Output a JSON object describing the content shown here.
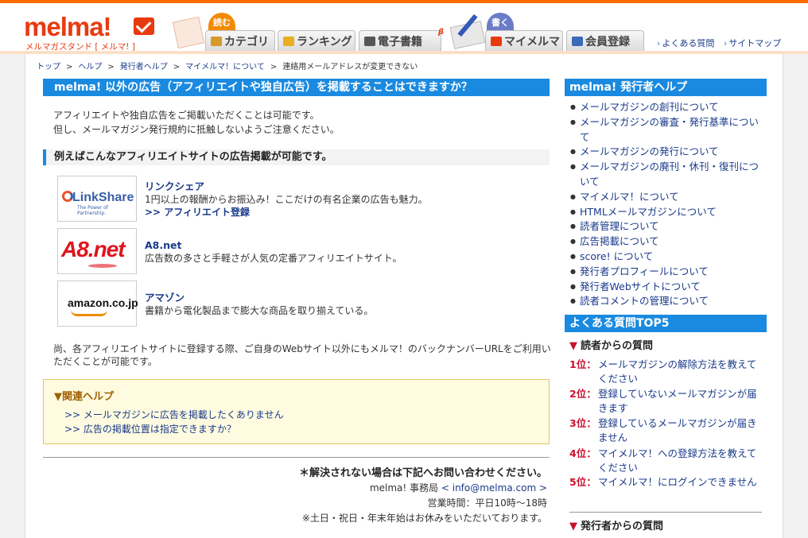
{
  "brand": {
    "name": "melma!",
    "tagline": "メルマガスタンド [ メルマ! ]"
  },
  "modes": {
    "read": "読む",
    "write": "書く"
  },
  "nav": {
    "tabs": [
      {
        "label": "カテゴリ"
      },
      {
        "label": "ランキング"
      },
      {
        "label": "電子書籍",
        "badge": "β"
      },
      {
        "label": "マイメルマ"
      },
      {
        "label": "会員登録"
      }
    ]
  },
  "toplinks": [
    "よくある質問",
    "サイトマップ"
  ],
  "breadcrumb": [
    "トップ",
    "ヘルプ",
    "発行者ヘルプ",
    "マイメルマ！について",
    "連絡用メールアドレスが変更できない"
  ],
  "breadcrumb_sep": ">",
  "main": {
    "title": "melma! 以外の広告（アフィリエイトや独自広告）を掲載することはできますか？",
    "intro": [
      "アフィリエイトや独自広告をご掲載いただくことは可能です。",
      "但し、メールマガジン発行規約に抵触しないようご注意ください。"
    ],
    "subhead": "例えばこんなアフィリエイトサイトの広告掲載が可能です。",
    "affiliates": [
      {
        "logo": "LinkShare",
        "logo_tag": "The Power of Partnership.",
        "name": "リンクシェア",
        "desc": "1円以上の報酬からお振込み！ここだけの有名企業の広告も魅力。",
        "register": ">> アフィリエイト登録"
      },
      {
        "logo": "A8.net",
        "name": "A8.net",
        "desc": "広告数の多さと手軽さが人気の定番アフィリエイトサイト。"
      },
      {
        "logo": "amazon.co.jp",
        "name": "アマゾン",
        "desc": "書籍から電化製品まで膨大な商品を取り揃えている。"
      }
    ],
    "note": "尚、各アフィリエイトサイトに登録する際、ご自身のWebサイト以外にもメルマ！のバックナンバーURLをご利用いただくことが可能です。",
    "related": {
      "title": "▼関連ヘルプ",
      "items": [
        ">> メールマガジンに広告を掲載したくありません",
        ">> 広告の掲載位置は指定できますか？"
      ]
    },
    "contact": {
      "head": "＊解決されない場合は下記へお問い合わせください。",
      "office_prefix": "melma! 事務局",
      "email": "< info@melma.com >",
      "hours": "営業時間：平日10時〜18時",
      "holiday": "※土日・祝日・年末年始はお休みをいただいております。"
    }
  },
  "sidebar": {
    "help_title": "melma! 発行者ヘルプ",
    "help_items": [
      "メールマガジンの創刊について",
      "メールマガジンの審査・発行基準について",
      "メールマガジンの発行について",
      "メールマガジンの廃刊・休刊・復刊について",
      "マイメルマ！について",
      "HTMLメールマガジンについて",
      "読者管理について",
      "広告掲載について",
      "score! について",
      "発行者プロフィールについて",
      "発行者Webサイトについて",
      "読者コメントの管理について"
    ],
    "faq_title": "よくある質問TOP5",
    "reader_head": "読者からの質問",
    "reader_faq": [
      {
        "rank": "1位：",
        "text": "メールマガジンの解除方法を教えてください"
      },
      {
        "rank": "2位：",
        "text": "登録していないメールマガジンが届きます"
      },
      {
        "rank": "3位：",
        "text": "登録しているメールマガジンが届きません"
      },
      {
        "rank": "4位：",
        "text": "マイメルマ！への登録方法を教えてください"
      },
      {
        "rank": "5位：",
        "text": "マイメルマ！にログインできません"
      }
    ],
    "publisher_head": "発行者からの質問"
  },
  "colors": {
    "brand": "#e83a10",
    "accent": "#1a8ae0",
    "rank": "#c8102e",
    "link": "#1a3a8a"
  }
}
